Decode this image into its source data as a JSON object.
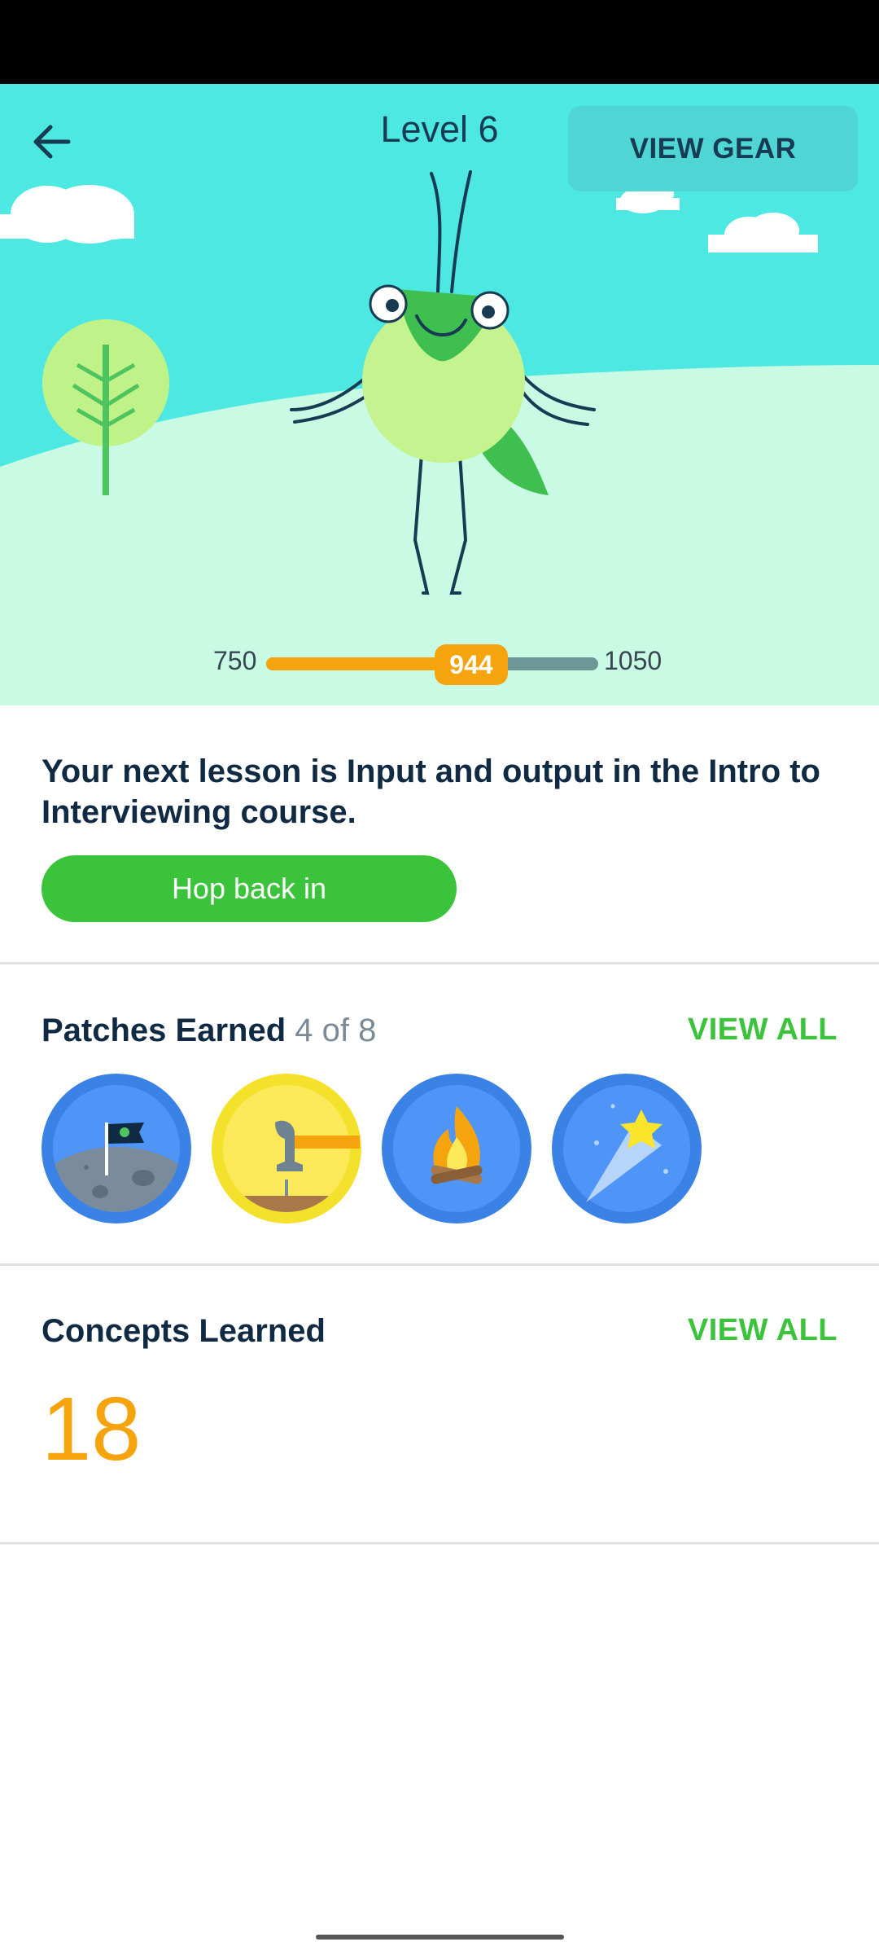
{
  "header": {
    "title": "Level 6",
    "gear_button": "VIEW GEAR"
  },
  "xp": {
    "min": "750",
    "max": "1050",
    "current": "944",
    "progress_fraction": 0.647
  },
  "lesson": {
    "text": "Your next lesson is Input and output in the Intro to Interviewing course.",
    "button": "Hop back in"
  },
  "patches": {
    "title": "Patches Earned",
    "count": "4 of 8",
    "view_all": "VIEW ALL",
    "items": [
      {
        "icon": "moon-flag-icon"
      },
      {
        "icon": "hammer-icon"
      },
      {
        "icon": "campfire-icon"
      },
      {
        "icon": "shooting-star-icon"
      }
    ]
  },
  "concepts": {
    "title": "Concepts Learned",
    "view_all": "VIEW ALL",
    "count": "18"
  },
  "colors": {
    "sky": "#4ee8e2",
    "grass": "#c9fbe4",
    "accent_green": "#3cc33c",
    "accent_orange": "#f5a40e",
    "text_dark": "#102a43"
  }
}
